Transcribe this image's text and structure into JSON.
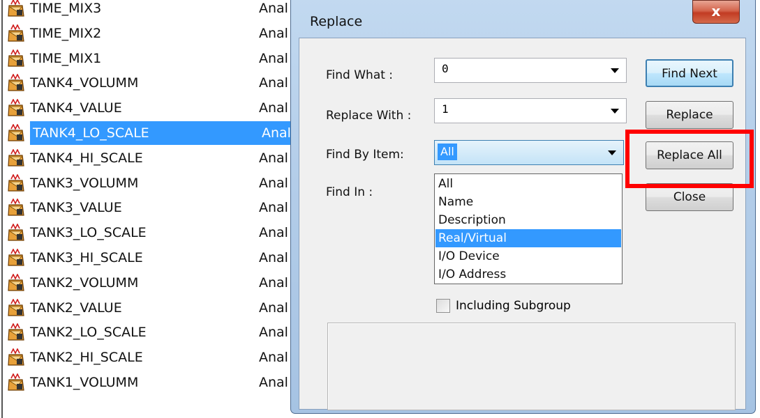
{
  "tag_list": {
    "rows": [
      {
        "name": "TIME_MIX3",
        "type": "Anal"
      },
      {
        "name": "TIME_MIX2",
        "type": "Anal"
      },
      {
        "name": "TIME_MIX1",
        "type": "Anal"
      },
      {
        "name": "TANK4_VOLUMM",
        "type": "Anal"
      },
      {
        "name": "TANK4_VALUE",
        "type": "Anal"
      },
      {
        "name": "TANK4_LO_SCALE",
        "type": "Anal"
      },
      {
        "name": "TANK4_HI_SCALE",
        "type": "Anal"
      },
      {
        "name": "TANK3_VOLUMM",
        "type": "Anal"
      },
      {
        "name": "TANK3_VALUE",
        "type": "Anal"
      },
      {
        "name": "TANK3_LO_SCALE",
        "type": "Anal"
      },
      {
        "name": "TANK3_HI_SCALE",
        "type": "Anal"
      },
      {
        "name": "TANK2_VOLUMM",
        "type": "Anal"
      },
      {
        "name": "TANK2_VALUE",
        "type": "Anal"
      },
      {
        "name": "TANK2_LO_SCALE",
        "type": "Anal"
      },
      {
        "name": "TANK2_HI_SCALE",
        "type": "Anal"
      },
      {
        "name": "TANK1_VOLUMM",
        "type": "Anal"
      }
    ],
    "selected_row": "TANK4_LO_SCALE",
    "row_icon": "analog-tag-icon"
  },
  "dialog": {
    "title": "Replace",
    "close_glyph": "x",
    "find_what": {
      "label": "Find What :",
      "value": "0"
    },
    "replace_with": {
      "label": "Replace With :",
      "value": "1"
    },
    "find_by_item": {
      "label": "Find By Item:",
      "value": "All",
      "options": [
        "All",
        "Name",
        "Description",
        "Real/Virtual",
        "I/O Device",
        "I/O Address"
      ],
      "hovered_option": "Real/Virtual"
    },
    "find_in": {
      "label": "Find In :"
    },
    "including_subgroup": {
      "label": "Including Subgroup",
      "checked": false
    },
    "buttons": {
      "find_next": "Find Next",
      "replace": "Replace",
      "replace_all": "Replace All",
      "close": "Close"
    }
  },
  "colors": {
    "selection": "#3399ff",
    "annotation": "#ff0000",
    "dialog_frame": "#b3cde9"
  }
}
